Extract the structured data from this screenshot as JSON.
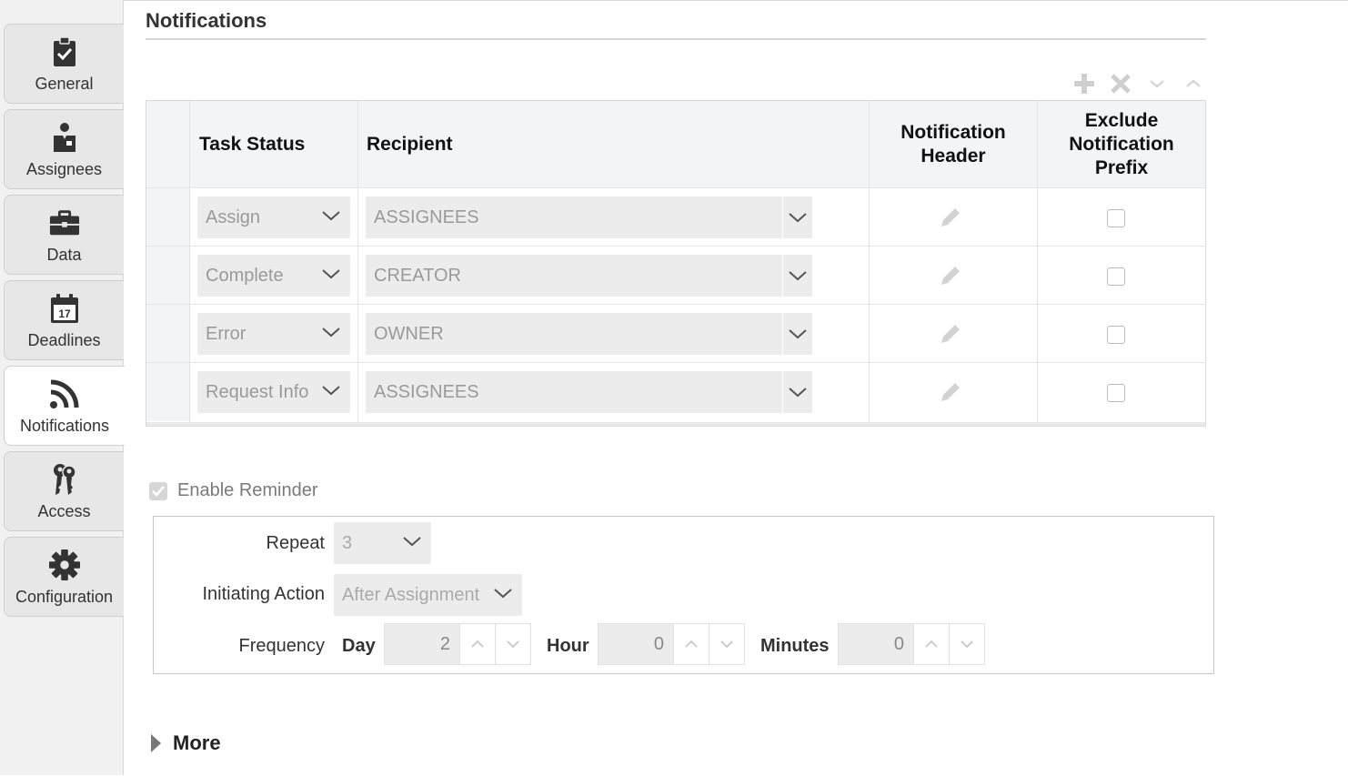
{
  "sidebar": {
    "tabs": [
      {
        "label": "General",
        "icon": "clipboard-check-icon"
      },
      {
        "label": "Assignees",
        "icon": "user-badge-icon"
      },
      {
        "label": "Data",
        "icon": "briefcase-icon"
      },
      {
        "label": "Deadlines",
        "icon": "calendar-icon",
        "calendar_day": "17"
      },
      {
        "label": "Notifications",
        "icon": "rss-icon",
        "active": true
      },
      {
        "label": "Access",
        "icon": "keys-icon"
      },
      {
        "label": "Configuration",
        "icon": "gear-icon"
      }
    ]
  },
  "page": {
    "title": "Notifications"
  },
  "toolbar": {
    "icons": [
      "plus-icon",
      "close-icon",
      "chevron-down-icon",
      "chevron-up-icon"
    ]
  },
  "table": {
    "headers": {
      "task_status": "Task Status",
      "recipient": "Recipient",
      "notification_header": "Notification Header",
      "exclude_prefix": "Exclude Notification Prefix"
    },
    "rows": [
      {
        "task_status": "Assign",
        "recipient": "ASSIGNEES",
        "exclude_prefix": false
      },
      {
        "task_status": "Complete",
        "recipient": "CREATOR",
        "exclude_prefix": false
      },
      {
        "task_status": "Error",
        "recipient": "OWNER",
        "exclude_prefix": false
      },
      {
        "task_status": "Request Info",
        "recipient": "ASSIGNEES",
        "exclude_prefix": false
      }
    ]
  },
  "reminder": {
    "enable_label": "Enable Reminder",
    "enabled": true,
    "repeat_label": "Repeat",
    "repeat_value": "3",
    "initiating_action_label": "Initiating Action",
    "initiating_action_value": "After Assignment",
    "frequency_label": "Frequency",
    "day_label": "Day",
    "day_value": "2",
    "hour_label": "Hour",
    "hour_value": "0",
    "minutes_label": "Minutes",
    "minutes_value": "0"
  },
  "more": {
    "label": "More"
  },
  "colors": {
    "tab_bg": "#e7e7e7",
    "active_tab_bg": "#ffffff",
    "header_bg": "#f3f4f6",
    "select_bg": "#ececec",
    "icon_dark": "#333333",
    "icon_muted": "#cfcfcf"
  }
}
